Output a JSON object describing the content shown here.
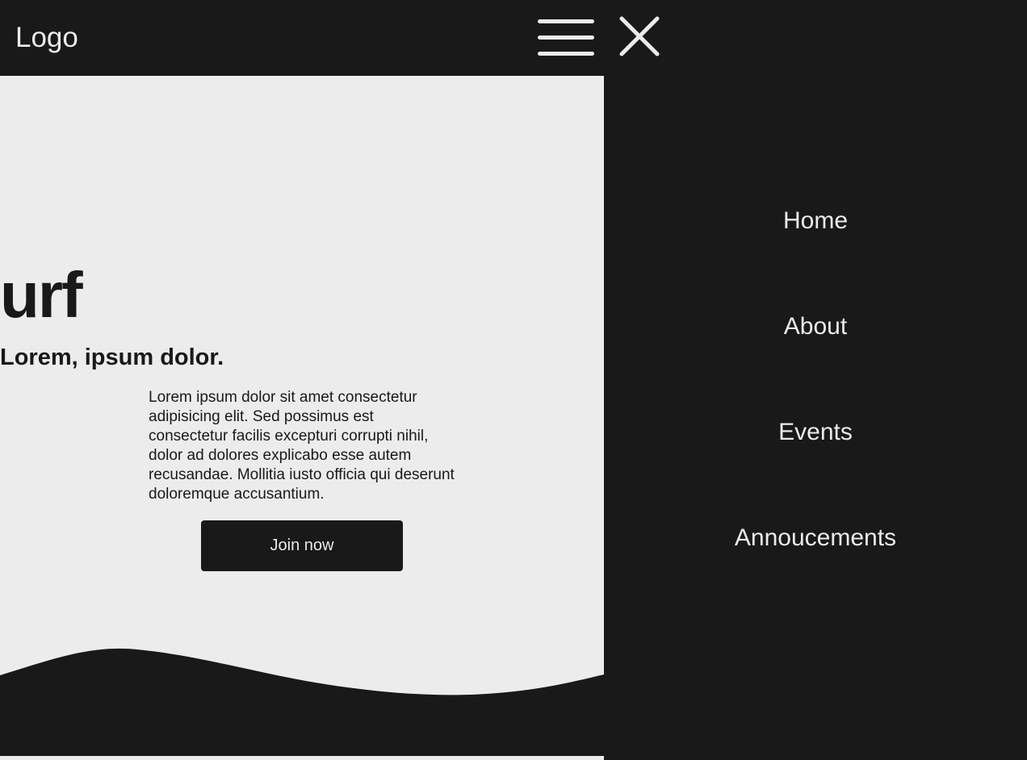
{
  "header": {
    "logo": "Logo",
    "menu_icon": "hamburger-icon",
    "close_icon": "close-icon"
  },
  "hero": {
    "title": "urf",
    "subtitle": "Lorem, ipsum dolor.",
    "text": "Lorem ipsum dolor sit amet consectetur adipisicing elit. Sed possimus est consectetur facilis excepturi corrupti nihil, dolor ad dolores explicabo esse autem recusandae. Mollitia iusto officia qui deserunt doloremque accusantium.",
    "button_label": "Join now"
  },
  "nav": {
    "items": [
      {
        "label": "Home"
      },
      {
        "label": "About"
      },
      {
        "label": "Events"
      },
      {
        "label": "Annoucements"
      }
    ]
  },
  "colors": {
    "dark": "#191919",
    "light": "#ececec",
    "text_light": "#ebebeb"
  }
}
